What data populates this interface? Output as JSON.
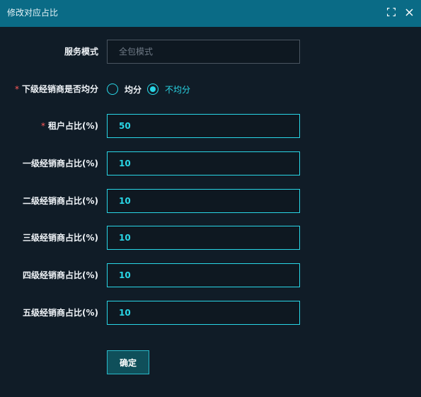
{
  "dialog": {
    "title": "修改对应占比",
    "fullscreen_icon": "fullscreen-icon",
    "close_icon": "close-icon"
  },
  "form": {
    "service_mode": {
      "label": "服务模式",
      "placeholder": "全包模式",
      "value": ""
    },
    "even_split": {
      "required_mark": "*",
      "label": "下级经销商是否均分",
      "options": [
        {
          "label": "均分",
          "checked": false
        },
        {
          "label": "不均分",
          "checked": true
        }
      ]
    },
    "tenant_ratio": {
      "required_mark": "*",
      "label": "租户占比(%)",
      "value": "50"
    },
    "level1_ratio": {
      "label": "一级经销商占比(%)",
      "value": "10"
    },
    "level2_ratio": {
      "label": "二级经销商占比(%)",
      "value": "10"
    },
    "level3_ratio": {
      "label": "三级经销商占比(%)",
      "value": "10"
    },
    "level4_ratio": {
      "label": "四级经销商占比(%)",
      "value": "10"
    },
    "level5_ratio": {
      "label": "五级经销商占比(%)",
      "value": "10"
    },
    "confirm_label": "确定"
  },
  "colors": {
    "titlebar_bg": "#0a6b86",
    "body_bg": "#101c27",
    "accent": "#29d6e6",
    "required": "#ff5a5a"
  }
}
